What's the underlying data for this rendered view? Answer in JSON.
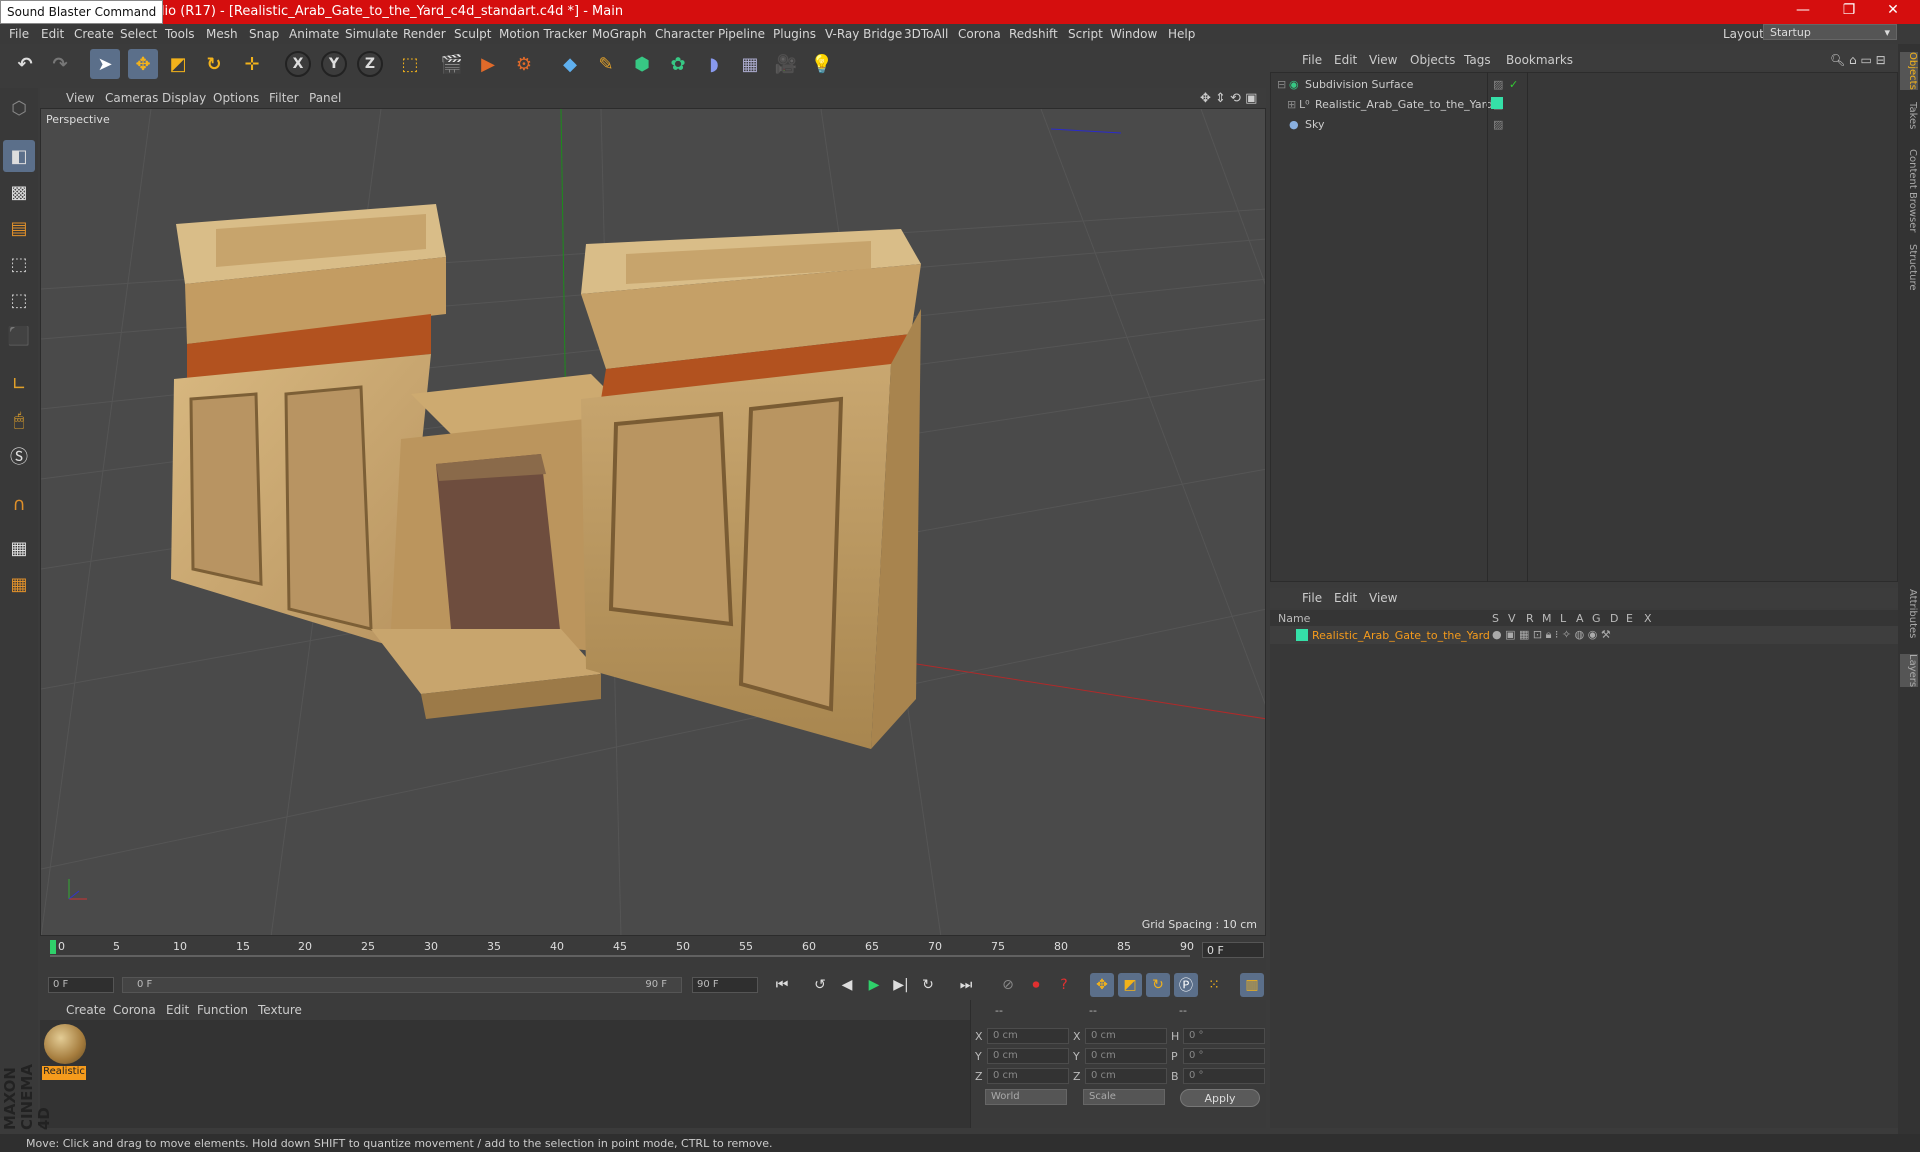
{
  "window": {
    "tooltip": "Sound Blaster Command",
    "title": "udio (R17) - [Realistic_Arab_Gate_to_the_Yard_c4d_standart.c4d *] - Main"
  },
  "menu": {
    "items": [
      "File",
      "Edit",
      "Create",
      "Select",
      "Tools",
      "Mesh",
      "Snap",
      "Animate",
      "Simulate",
      "Render",
      "Sculpt",
      "Motion Tracker",
      "MoGraph",
      "Character",
      "Pipeline",
      "Plugins",
      "V-Ray Bridge",
      "3DToAll",
      "Corona",
      "Redshift",
      "Script",
      "Window",
      "Help"
    ],
    "layout_label": "Layout:",
    "layout_value": "Startup"
  },
  "viewport": {
    "menu": [
      "View",
      "Cameras",
      "Display",
      "Options",
      "Filter",
      "Panel"
    ],
    "label": "Perspective",
    "grid_spacing": "Grid Spacing : 10 cm"
  },
  "timeline": {
    "ticks": [
      "0",
      "5",
      "10",
      "15",
      "20",
      "25",
      "30",
      "35",
      "40",
      "45",
      "50",
      "55",
      "60",
      "65",
      "70",
      "75",
      "80",
      "85",
      "90"
    ],
    "current": "0 F",
    "start": "0 F",
    "range_start": "0 F",
    "range_end": "90 F",
    "end": "90 F"
  },
  "material": {
    "menu": [
      "Create",
      "Corona",
      "Edit",
      "Function",
      "Texture"
    ],
    "name": "Realistic"
  },
  "coordinates": {
    "headers": [
      "--",
      "--",
      "--"
    ],
    "rows": [
      {
        "a": "X",
        "v1": "0 cm",
        "b": "X",
        "v2": "0 cm",
        "c": "H",
        "v3": "0 °"
      },
      {
        "a": "Y",
        "v1": "0 cm",
        "b": "Y",
        "v2": "0 cm",
        "c": "P",
        "v3": "0 °"
      },
      {
        "a": "Z",
        "v1": "0 cm",
        "b": "Z",
        "v2": "0 cm",
        "c": "B",
        "v3": "0 °"
      }
    ],
    "world": "World",
    "scale": "Scale",
    "apply": "Apply"
  },
  "objects": {
    "menu": [
      "File",
      "Edit",
      "View",
      "Objects",
      "Tags",
      "Bookmarks"
    ],
    "items": [
      "Subdivision Surface",
      "Realistic_Arab_Gate_to_the_Yard",
      "Sky"
    ]
  },
  "layers": {
    "menu": [
      "File",
      "Edit",
      "View"
    ],
    "columns": [
      "Name",
      "S",
      "V",
      "R",
      "M",
      "L",
      "A",
      "G",
      "D",
      "E",
      "X"
    ],
    "item": "Realistic_Arab_Gate_to_the_Yard"
  },
  "side_tabs": [
    "Objects",
    "Takes",
    "Content Browser",
    "Structure",
    "Attributes",
    "Layers"
  ],
  "brand": "MAXON CINEMA 4D",
  "status": "Move: Click and drag to move elements. Hold down SHIFT to quantize movement / add to the selection in point mode, CTRL to remove.",
  "colors": {
    "title_bar": "#d50e0e",
    "accent_orange": "#f59b1c",
    "layer_green": "#35e0a8"
  }
}
